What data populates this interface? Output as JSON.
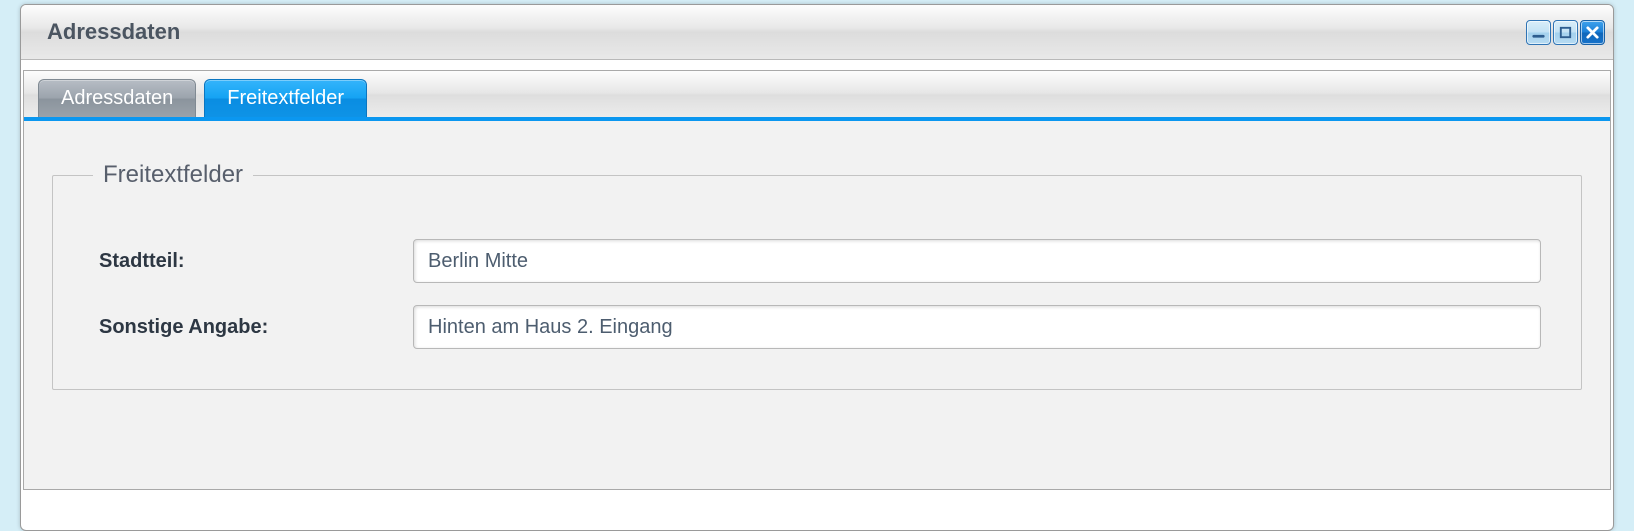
{
  "window": {
    "title": "Adressdaten"
  },
  "tabs": {
    "adressdaten": {
      "label": "Adressdaten"
    },
    "freitext": {
      "label": "Freitextfelder",
      "active": true
    }
  },
  "group": {
    "legend": "Freitextfelder"
  },
  "fields": {
    "stadtteil": {
      "label": "Stadtteil:",
      "value": "Berlin Mitte"
    },
    "sonstige": {
      "label": "Sonstige Angabe:",
      "value": "Hinten am Haus 2. Eingang"
    }
  }
}
